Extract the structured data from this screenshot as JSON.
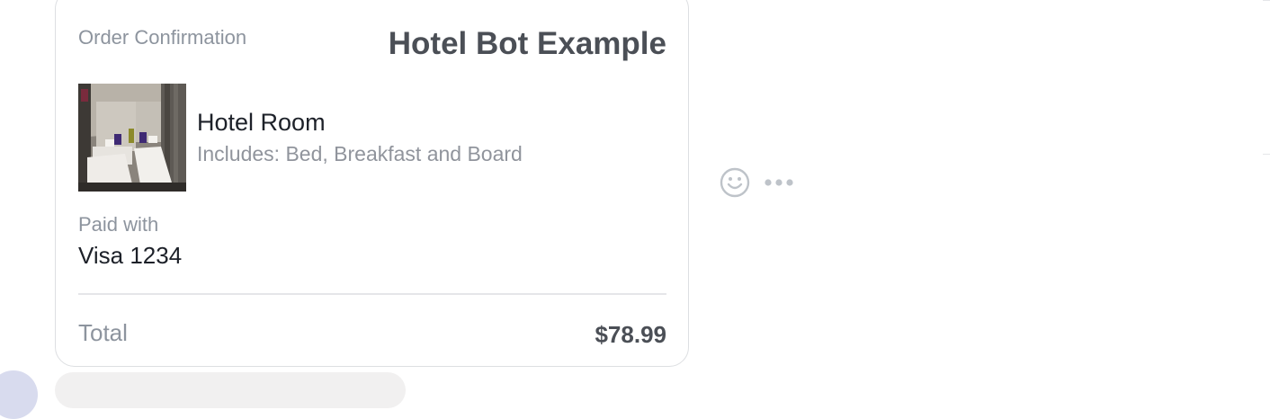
{
  "receipt": {
    "header_label": "Order Confirmation",
    "merchant_name": "Hotel Bot Example",
    "item": {
      "title": "Hotel Room",
      "subtitle": "Includes: Bed, Breakfast and Board",
      "image_icon": "hotel-room-photo"
    },
    "payment": {
      "label": "Paid with",
      "method": "Visa 1234"
    },
    "total": {
      "label": "Total",
      "amount": "$78.99"
    }
  },
  "message_actions": {
    "react_icon": "smiley-icon",
    "more_icon": "more-dots-icon"
  },
  "colors": {
    "card_border": "#dddfe2",
    "muted_text": "#8d949e",
    "strong_text": "#4b4f56",
    "body_text": "#1d2129",
    "icon_gray": "#bec3c9"
  }
}
